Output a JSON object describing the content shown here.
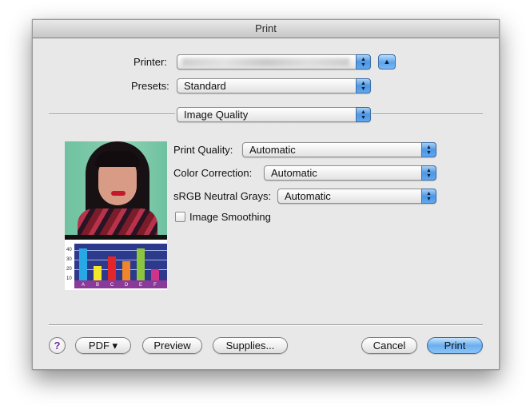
{
  "window": {
    "title": "Print"
  },
  "printer": {
    "label": "Printer:",
    "value": ""
  },
  "presets": {
    "label": "Presets:",
    "value": "Standard"
  },
  "panel": {
    "value": "Image Quality"
  },
  "options": {
    "print_quality": {
      "label": "Print Quality:",
      "value": "Automatic"
    },
    "color_correction": {
      "label": "Color Correction:",
      "value": "Automatic"
    },
    "srgb_neutral_grays": {
      "label": "sRGB Neutral Grays:",
      "value": "Automatic"
    },
    "image_smoothing": {
      "label": "Image Smoothing",
      "checked": false
    }
  },
  "preview_chart": {
    "y_ticks": [
      "40",
      "30",
      "20",
      "10"
    ],
    "categories": [
      "A",
      "B",
      "C",
      "D",
      "E",
      "F"
    ],
    "bar_colors": [
      "#29a8e6",
      "#f4e62a",
      "#e2262a",
      "#f0852a",
      "#8cc63f",
      "#d0338c"
    ]
  },
  "footer": {
    "help": "?",
    "pdf": "PDF ▾",
    "preview": "Preview",
    "supplies": "Supplies...",
    "cancel": "Cancel",
    "print": "Print"
  },
  "icons": {
    "stepper": "up-down-arrows-icon",
    "disclosure": "triangle-up-icon"
  }
}
